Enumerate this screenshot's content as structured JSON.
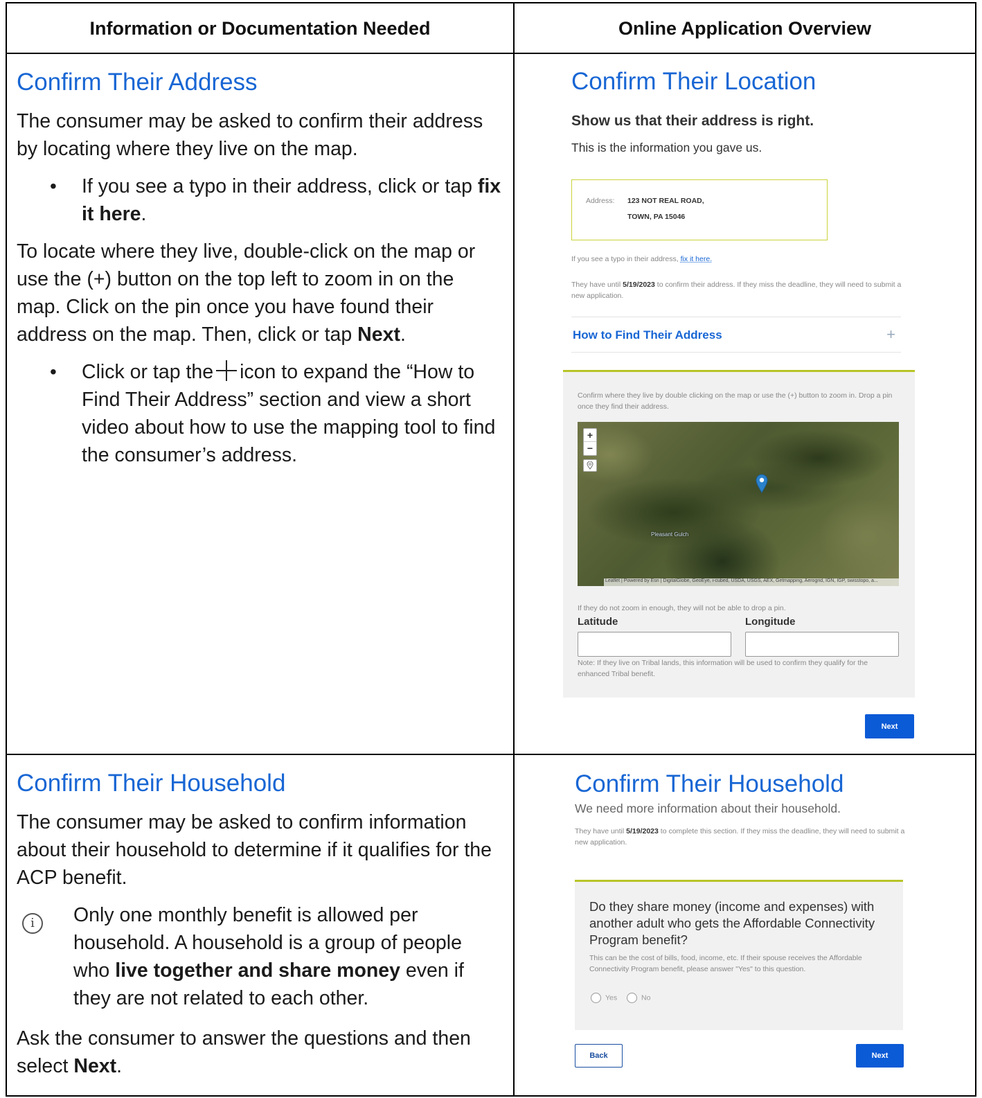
{
  "headers": {
    "left": "Information or Documentation Needed",
    "right": "Online Application Overview"
  },
  "address_section": {
    "title": "Confirm Their Address",
    "intro": "The consumer may be asked to confirm their address by locating where they live on the map.",
    "bullet1_pre": "If you see a typo in their address, click or tap ",
    "bullet1_bold": "fix it here",
    "bullet1_post": ".",
    "locate_pre": "To locate where they live, double-click on the map or use the (+) button on the top left to zoom in on the map. Click on the pin once you have found their address on the map. Then, click or tap ",
    "locate_bold": "Next",
    "locate_post": ".",
    "bullet2_pre": "Click or tap the",
    "bullet2_post": "icon to expand the “How to Find Their Address” section and view a short video about how to use the mapping tool to find the consumer’s address."
  },
  "location_ui": {
    "title": "Confirm Their Location",
    "subtitle": "Show us that their address is right.",
    "info_text": "This is the information you gave us.",
    "address_label": "Address:",
    "address_line1": "123 NOT REAL ROAD,",
    "address_line2": "TOWN, PA 15046",
    "typo_pre": "If you see a typo in their address, ",
    "typo_link": "fix it here.",
    "deadline_pre": "They have until ",
    "deadline_date": "5/19/2023",
    "deadline_post": " to confirm their address. If they miss the deadline, they will need to submit a new application.",
    "accordion_label": "How to Find Their Address",
    "map_instructions": "Confirm where they live by double clicking on the map or use the (+) button to zoom in. Drop a pin once they find their address.",
    "map_place_label": "Pleasant Gulch",
    "map_attribution": "Leaflet | Powered by Esri | DigitalGlobe, GeoEye, i-cubed, USDA, USGS, AEX, Getmapping, Aerogrid, IGN, IGP, swisstopo, a...",
    "zoom_in": "+",
    "zoom_out": "−",
    "zoom_note": "If they do not zoom in enough, they will not be able to drop a pin.",
    "latitude_label": "Latitude",
    "longitude_label": "Longitude",
    "tribal_note": "Note: If they live on Tribal lands, this information will be used to confirm they qualify for the enhanced Tribal benefit.",
    "next_label": "Next"
  },
  "household_section": {
    "title": "Confirm Their Household",
    "intro": "The consumer may be asked to confirm information about their household to determine if it qualifies for the ACP benefit.",
    "info_icon": "i",
    "note_pre": "Only one monthly benefit is allowed per household. A household is a group of people who ",
    "note_bold": "live together and share money",
    "note_post": " even if they are not related to each other.",
    "ask_pre": "Ask the consumer to answer the questions and then select ",
    "ask_bold": "Next",
    "ask_post": "."
  },
  "household_ui": {
    "title": "Confirm Their Household",
    "subtitle": "We need more information about their household.",
    "deadline_pre": "They have until ",
    "deadline_date": "5/19/2023",
    "deadline_post": " to complete this section. If they miss the deadline, they will need to submit a new application.",
    "question": "Do they share money (income and expenses) with another adult who gets the Affordable Connectivity Program benefit?",
    "question_help": "This can be the cost of bills, food, income, etc. If their spouse receives the Affordable Connectivity Program benefit, please answer \"Yes\" to this question.",
    "yes_label": "Yes",
    "no_label": "No",
    "back_label": "Back",
    "next_label": "Next"
  },
  "colors": {
    "heading_blue": "#1866d4",
    "accent_yellow_green": "#b8c428",
    "button_blue": "#0b5ad6"
  }
}
